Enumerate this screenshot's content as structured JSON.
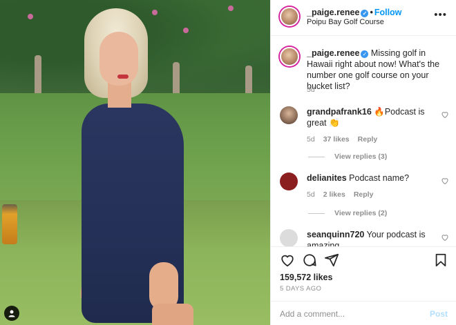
{
  "post": {
    "username": "_paige.renee",
    "follow_label": "Follow",
    "location": "Poipu Bay Golf Course",
    "more_label": "•••",
    "caption": "Missing golf in Hawaii right about now! What's the number one golf course on your bucket list?",
    "caption_age": "5d",
    "likes": "159,572 likes",
    "posted": "5 DAYS AGO"
  },
  "comments": [
    {
      "username": "grandpafrank16",
      "text": "🔥Podcast is great 👏",
      "age": "5d",
      "likes": "37 likes",
      "reply": "Reply",
      "view_replies": "View replies (3)"
    },
    {
      "username": "delianites",
      "text": "Podcast name?",
      "age": "5d",
      "likes": "2 likes",
      "reply": "Reply",
      "view_replies": "View replies (2)"
    },
    {
      "username": "seanquinn720",
      "text": "Your podcast is amazing"
    }
  ],
  "add_comment": {
    "placeholder": "Add a comment...",
    "post_label": "Post"
  },
  "colors": {
    "link": "#0095f6",
    "muted": "#8e8e8e",
    "post_disabled": "#b2dffc",
    "verified": "#3897f0"
  },
  "icons": [
    "heart-icon",
    "comment-icon",
    "share-icon",
    "bookmark-icon",
    "user-tag-icon",
    "verified-icon"
  ]
}
